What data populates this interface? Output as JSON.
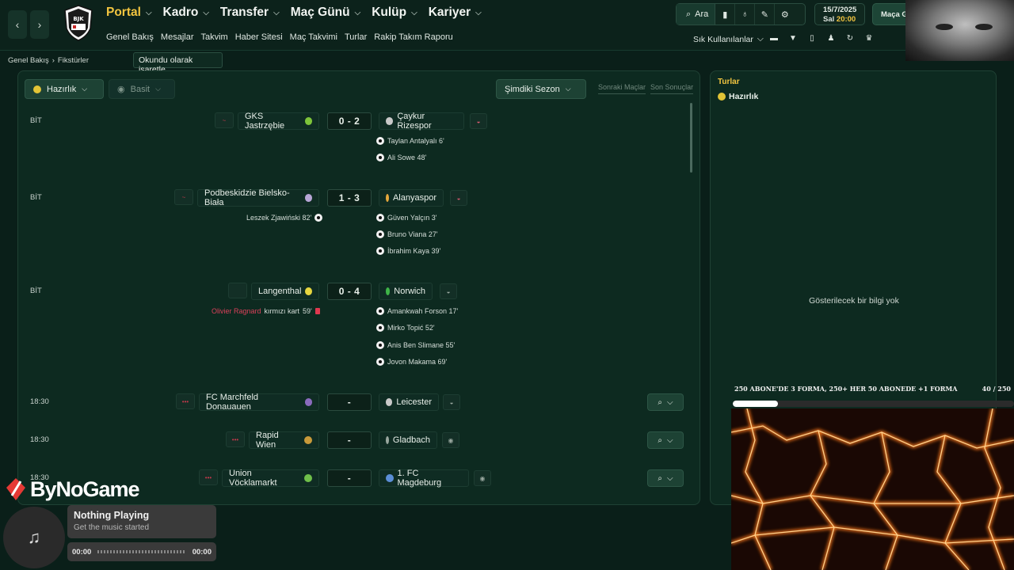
{
  "nav": {
    "main": [
      {
        "label": "Portal",
        "active": true
      },
      {
        "label": "Kadro",
        "active": false
      },
      {
        "label": "Transfer",
        "active": false
      },
      {
        "label": "Maç Günü",
        "active": false
      },
      {
        "label": "Kulüp",
        "active": false
      },
      {
        "label": "Kariyer",
        "active": false
      }
    ],
    "sub": [
      "Genel Bakış",
      "Mesajlar",
      "Takvim",
      "Haber Sitesi",
      "Maç Takvimi",
      "Turlar",
      "Rakip Takım Raporu"
    ],
    "search_label": "Ara",
    "date": "15/7/2025",
    "day": "Sal",
    "time": "20:00",
    "go_match": "Maça Git",
    "shortcuts": "Sık Kullanılanlar",
    "club_logo_text": "BJK"
  },
  "breadcrumb": [
    "Genel Bakış",
    "Fikstürler"
  ],
  "tooltip": "Okundu olarak işaretle",
  "filters": {
    "competition": "Hazırlık",
    "view": "Basit",
    "season": "Şimdiki Sezon",
    "tab_next": "Sonraki Maçlar",
    "tab_results": "Son Sonuçlar"
  },
  "fixtures": [
    {
      "status": "BİT",
      "home": "GKS Jastrzębie",
      "score": "0 - 2",
      "away": "Çaykur Rizespor",
      "home_events": [],
      "away_events": [
        "Taylan Antalyalı 6'",
        "Ali Sowe 48'"
      ]
    },
    {
      "status": "BİT",
      "home": "Podbeskidzie Bielsko-Biała",
      "score": "1 - 3",
      "away": "Alanyaspor",
      "home_events": [
        "Leszek Zjawiński 82'"
      ],
      "away_events": [
        "Güven Yalçın 3'",
        "Bruno Viana 27'",
        "İbrahim Kaya 39'"
      ]
    },
    {
      "status": "BİT",
      "home": "Langenthal",
      "score": "0 - 4",
      "away": "Norwich",
      "home_card": {
        "player": "Olivier Ragnard",
        "text": "kırmızı kart",
        "minute": "59'"
      },
      "away_events": [
        "Amankwah Forson 17'",
        "Mirko Topić 52'",
        "Anis Ben Slimane 55'",
        "Jovon Makama 69'"
      ]
    },
    {
      "status": "18:30",
      "home": "FC Marchfeld Donauauen",
      "score": "-",
      "away": "Leicester"
    },
    {
      "status": "18:30",
      "home": "Rapid Wien",
      "score": "-",
      "away": "Gladbach"
    },
    {
      "status": "18:30",
      "home": "Union Vöcklamarkt",
      "score": "-",
      "away": "1. FC Magdeburg"
    }
  ],
  "right_panel": {
    "title": "Turlar",
    "subtitle": "Hazırlık",
    "empty": "Gösterilecek bir bilgi yok"
  },
  "overlay": {
    "sub_goal": "250 ABONE'DE 3 FORMA, 250+ HER 50 ABONEDE +1 FORMA",
    "sub_count": "40 / 250",
    "sub_progress": 0.16,
    "brand": "ByNoGame",
    "music_title": "Nothing Playing",
    "music_sub": "Get the music started",
    "time_start": "00:00",
    "time_end": "00:00"
  },
  "colors": {
    "accent": "#f3c540",
    "bg": "#0a1f19",
    "panel": "#0d2a20",
    "red": "#e0384f"
  }
}
